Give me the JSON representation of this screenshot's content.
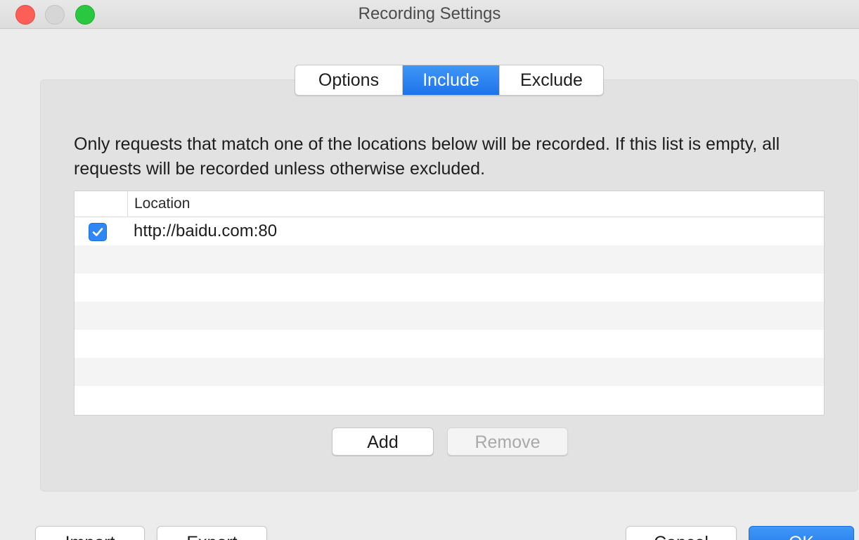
{
  "window": {
    "title": "Recording Settings"
  },
  "tabs": [
    {
      "label": "Options",
      "selected": false
    },
    {
      "label": "Include",
      "selected": true
    },
    {
      "label": "Exclude",
      "selected": false
    }
  ],
  "description": "Only requests that match one of the locations below will be recorded. If this list is empty, all requests will be recorded unless otherwise excluded.",
  "table": {
    "columns": [
      "",
      "Location"
    ],
    "rows": [
      {
        "enabled": true,
        "location": "http://baidu.com:80"
      }
    ]
  },
  "buttons": {
    "add": "Add",
    "remove": "Remove",
    "import": "Import",
    "export": "Export",
    "cancel": "Cancel",
    "ok": "OK"
  },
  "colors": {
    "accent": "#1d73ea",
    "close": "#fc5f57",
    "maximize": "#2ac840"
  }
}
